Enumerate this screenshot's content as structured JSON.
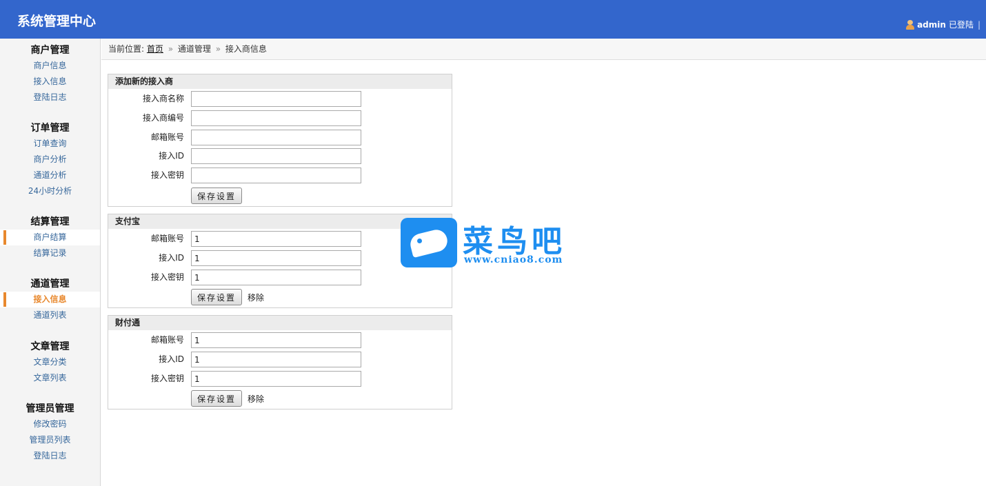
{
  "header": {
    "title": "系统管理中心",
    "user": "admin",
    "status": "已登陆",
    "separator": "|"
  },
  "sidebar": {
    "groups": [
      {
        "title": "商户管理",
        "items": [
          "商户信息",
          "接入信息",
          "登陆日志"
        ]
      },
      {
        "title": "订单管理",
        "items": [
          "订单查询",
          "商户分析",
          "通道分析",
          "24小时分析"
        ]
      },
      {
        "title": "结算管理",
        "items": [
          "商户结算",
          "结算记录"
        ]
      },
      {
        "title": "通道管理",
        "items": [
          "接入信息",
          "通道列表"
        ]
      },
      {
        "title": "文章管理",
        "items": [
          "文章分类",
          "文章列表"
        ]
      },
      {
        "title": "管理员管理",
        "items": [
          "修改密码",
          "管理员列表",
          "登陆日志"
        ]
      }
    ],
    "current": "通道管理 > 接入信息"
  },
  "breadcrumb": {
    "prefix": "当前位置:",
    "home": "首页",
    "arrow": "»",
    "level1": "通道管理",
    "level2": "接入商信息"
  },
  "panels": {
    "new": {
      "title": "添加新的接入商",
      "fields": [
        {
          "label": "接入商名称",
          "value": ""
        },
        {
          "label": "接入商编号",
          "value": ""
        },
        {
          "label": "邮箱账号",
          "value": ""
        },
        {
          "label": "接入ID",
          "value": ""
        },
        {
          "label": "接入密钥",
          "value": ""
        }
      ],
      "save": "保存设置"
    },
    "alipay": {
      "title": "支付宝",
      "fields": [
        {
          "label": "邮箱账号",
          "value": "1"
        },
        {
          "label": "接入ID",
          "value": "1"
        },
        {
          "label": "接入密钥",
          "value": "1"
        }
      ],
      "save": "保存设置",
      "remove": "移除"
    },
    "tenpay": {
      "title": "财付通",
      "fields": [
        {
          "label": "邮箱账号",
          "value": "1"
        },
        {
          "label": "接入ID",
          "value": "1"
        },
        {
          "label": "接入密钥",
          "value": "1"
        }
      ],
      "save": "保存设置",
      "remove": "移除"
    }
  },
  "watermark": {
    "name": "菜鸟吧",
    "url": "www.cniao8.com",
    "color": "#1e8ef0"
  },
  "colors": {
    "header_bg": "#3366cc",
    "accent": "#e8882d",
    "link": "#36679b"
  }
}
